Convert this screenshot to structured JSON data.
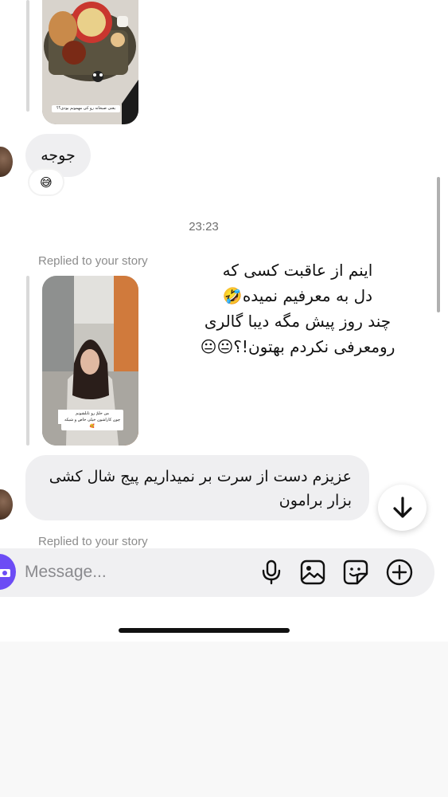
{
  "messages": {
    "first_story_caption": "یعنی صبحانه رو کی مهمونم بودی؟؟",
    "jooje_text": "جوجه",
    "reaction_emoji": "😅",
    "timestamp": "23:23",
    "replied_label_1": "Replied to your story",
    "story_overlay_lines": [
      "اینم  از عاقبت کسی که",
      "دل به معرفیم نمیده🤣",
      "چند روز پیش مگه دیبا گالری",
      "رومعرفی نکردم بهتون!؟😐😐"
    ],
    "second_story_caption_lines": [
      "من حلمٌ رو تابلشونم",
      "چون کاراشون خیلی خاص و شیکه🥰"
    ],
    "reply_text": "عزیزم دست از سرت بر نمیداریم پیج شال کشی بزار برامون",
    "replied_label_2": "Replied to your story"
  },
  "composer": {
    "placeholder": "Message..."
  },
  "icons": {
    "scroll_down": "arrow-down-icon",
    "camera": "camera-icon",
    "mic": "microphone-icon",
    "gallery": "image-icon",
    "sticker": "sticker-icon",
    "add": "plus-circle-icon"
  },
  "colors": {
    "bubble": "#efeff1",
    "camera_button": "#6c4cf5",
    "composer_bg": "#f0f0f2"
  }
}
